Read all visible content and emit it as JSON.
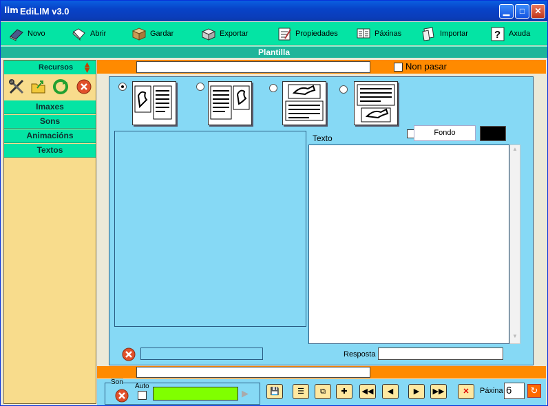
{
  "app": {
    "title": "EdiLIM  v3.0",
    "logo_text": "lim"
  },
  "toolbar": {
    "items": [
      {
        "label": "Novo",
        "icon": "book-icon"
      },
      {
        "label": "Abrir",
        "icon": "open-book-icon"
      },
      {
        "label": "Gardar",
        "icon": "box-icon"
      },
      {
        "label": "Exportar",
        "icon": "export-icon"
      },
      {
        "label": "Propiedades",
        "icon": "properties-icon"
      },
      {
        "label": "Páxinas",
        "icon": "pages-icon"
      },
      {
        "label": "Importar",
        "icon": "import-icon"
      },
      {
        "label": "Axuda",
        "icon": "help-icon"
      }
    ]
  },
  "section_title": "Plantilla",
  "sidebar": {
    "header": "Recursos",
    "items": [
      "Imaxes",
      "Sons",
      "Animacións",
      "Textos"
    ]
  },
  "top_field": {
    "value": "",
    "non_pasar_label": "Non pasar"
  },
  "editor": {
    "texto_label": "Texto",
    "fondo_label": "Fondo",
    "fondo_color": "#000000",
    "resposta_label": "Resposta",
    "resposta_value": ""
  },
  "bottom": {
    "son_label": "Son",
    "auto_label": "Auto",
    "paxina_label": "Páxina",
    "paxina_value": "6",
    "progress_color": "#80ff00"
  },
  "colors": {
    "accent": "#04e4a4",
    "orange": "#ff8a00",
    "panel": "#86d9f5",
    "sidebar": "#f8dc8c"
  }
}
